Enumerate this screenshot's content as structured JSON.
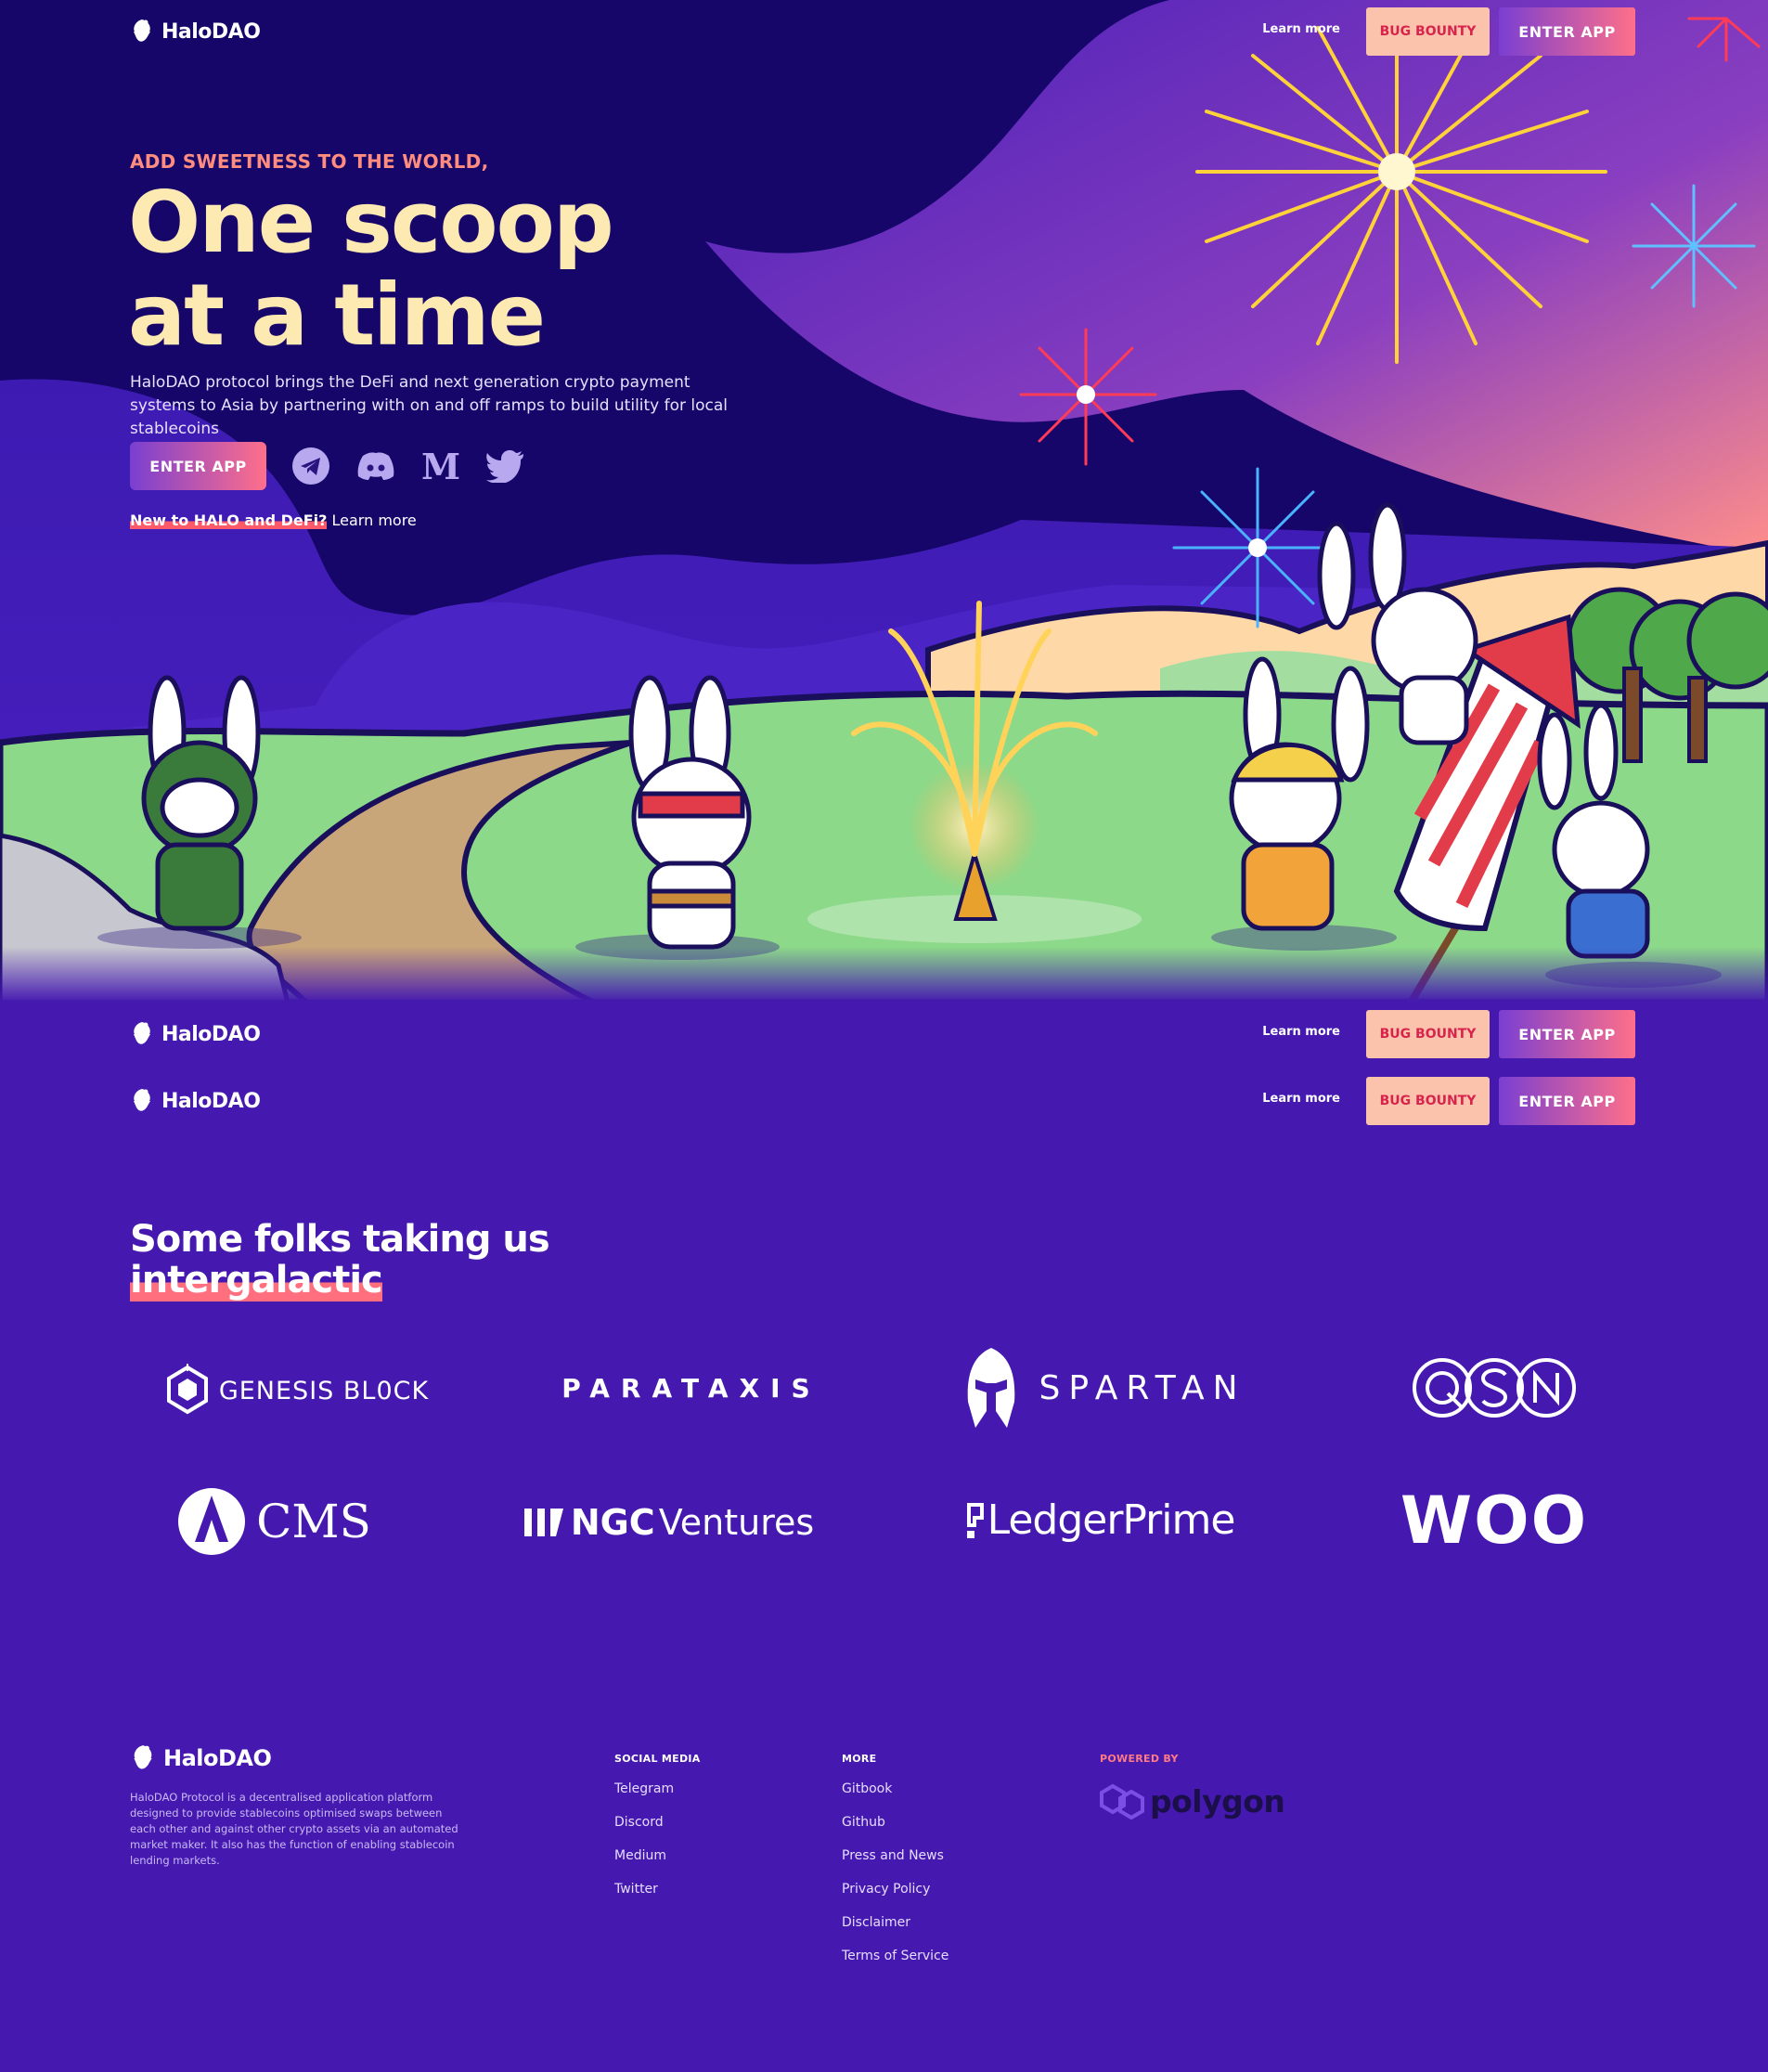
{
  "brand": {
    "name": "HaloDAO"
  },
  "nav": {
    "learn_more": "Learn more",
    "bug_bounty": "BUG BOUNTY",
    "enter_app": "ENTER APP"
  },
  "hero": {
    "eyebrow": "ADD SWEETNESS TO THE WORLD,",
    "headline_line1": "One scoop",
    "headline_line2": "at a time",
    "description": "HaloDAO protocol brings the DeFi and next generation crypto payment systems to Asia by partnering with on and off ramps to build utility for local stablecoins",
    "cta": "ENTER APP",
    "social_icons": [
      "telegram-icon",
      "discord-icon",
      "medium-icon",
      "twitter-icon"
    ],
    "new_to": "New to HALO and DeFi?",
    "learn_more": "Learn more"
  },
  "partners": {
    "title_line1": "Some folks taking us",
    "title_line2": "intergalactic",
    "logos": [
      "GENESIS BL0CK",
      "PARATAXIS",
      "SPARTAN",
      "QSN",
      "CMS",
      "NGC",
      "Ventures",
      "LedgerPrime",
      "WOO"
    ]
  },
  "footer": {
    "description": "HaloDAO Protocol is a decentralised application platform designed to provide stablecoins optimised swaps between each other and against other crypto assets via an automated market maker. It also has the function of enabling stablecoin lending markets.",
    "social_heading": "SOCIAL MEDIA",
    "social_links": [
      "Telegram",
      "Discord",
      "Medium",
      "Twitter"
    ],
    "more_heading": "MORE",
    "more_links": [
      "Gitbook",
      "Github",
      "Press and News",
      "Privacy Policy",
      "Disclaimer",
      "Terms of Service"
    ],
    "powered_by": "POWERED BY",
    "polygon": "polygon"
  },
  "colors": {
    "hero_bg": "#16066a",
    "page_bg": "#4519b0",
    "headline": "#fde9b2",
    "eyebrow": "#ff8c7e",
    "bounty_bg": "#fcc3ac",
    "bounty_text": "#d8234c"
  }
}
